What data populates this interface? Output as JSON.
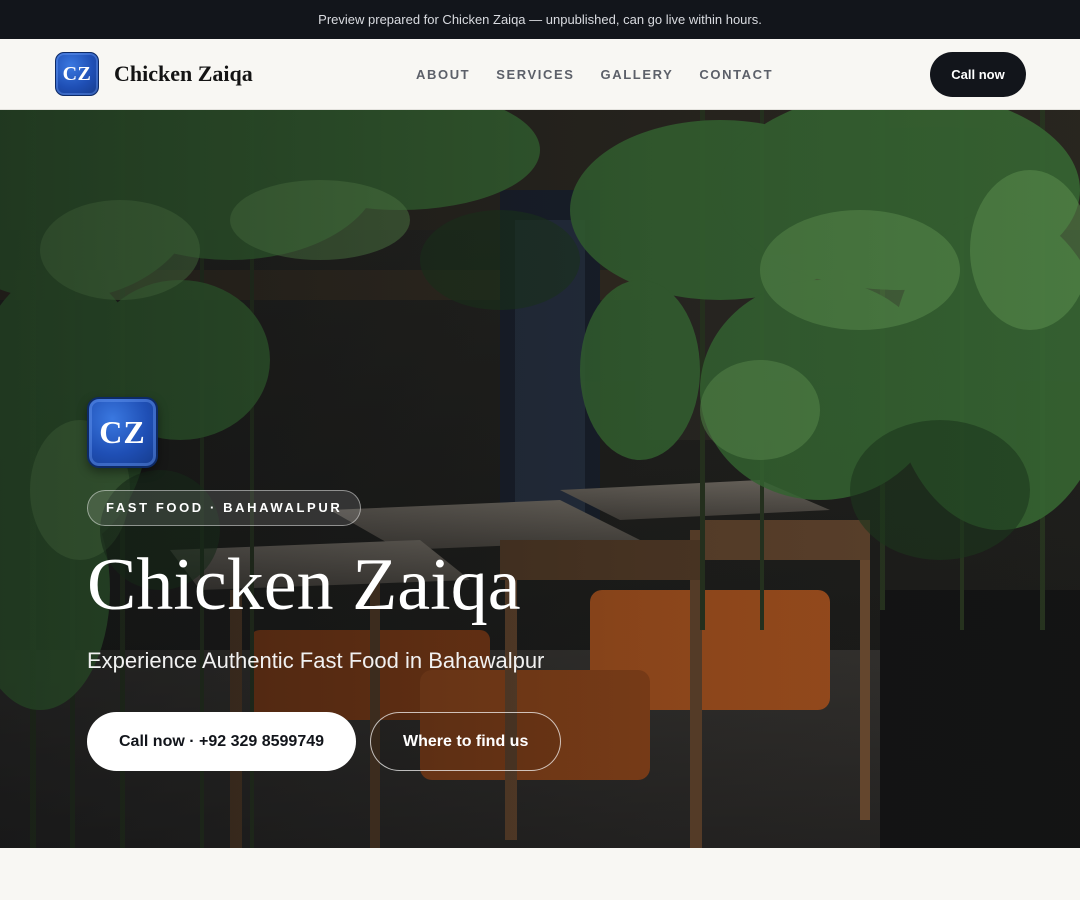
{
  "banner": {
    "text": "Preview prepared for Chicken Zaiqa — unpublished, can go live within hours."
  },
  "header": {
    "logo_text": "CZ",
    "brand_name": "Chicken Zaiqa",
    "nav": [
      {
        "label": "ABOUT"
      },
      {
        "label": "SERVICES"
      },
      {
        "label": "GALLERY"
      },
      {
        "label": "CONTACT"
      }
    ],
    "cta_label": "Call now"
  },
  "hero": {
    "logo_text": "CZ",
    "badge": "FAST FOOD · BAHAWALPUR",
    "title": "Chicken Zaiqa",
    "subtitle": "Experience Authentic Fast Food in Bahawalpur",
    "primary_button": "Call now · +92 329 8599749",
    "secondary_button": "Where to find us",
    "background_image": "restaurant-interior-with-bamboo-plants-and-wooden-chairs"
  },
  "colors": {
    "dark": "#12151b",
    "logo_blue": "#1f4fb5",
    "page_bg": "#f8f7f3",
    "chair_orange": "#b5581f"
  }
}
